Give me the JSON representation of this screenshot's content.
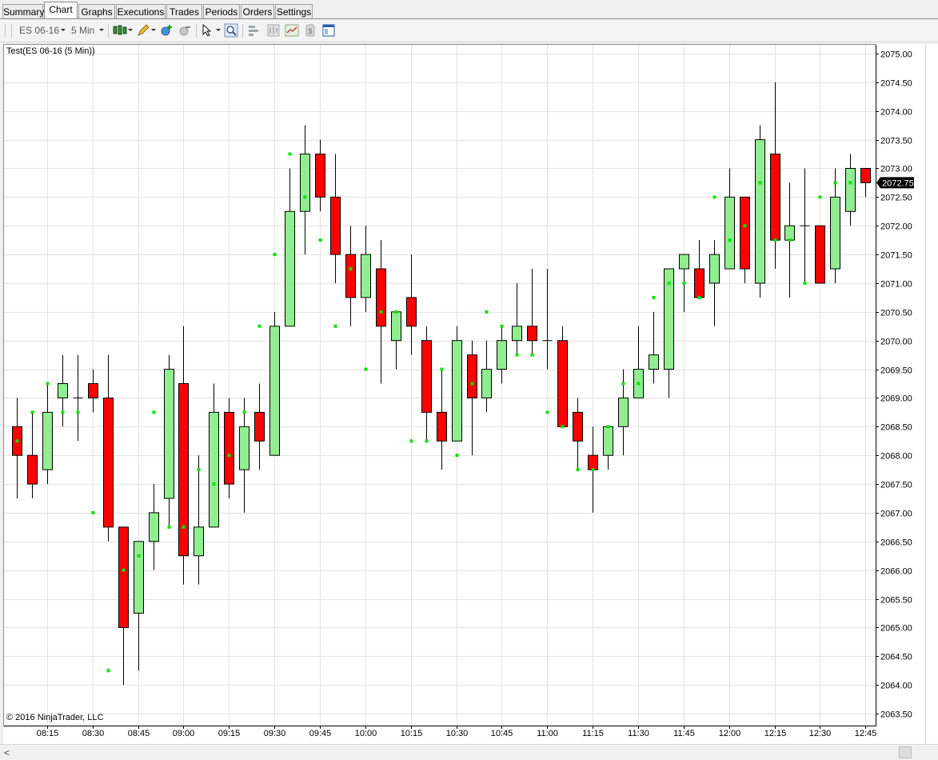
{
  "tabs": [
    {
      "label": "Summary",
      "active": false
    },
    {
      "label": "Chart",
      "active": true
    },
    {
      "label": "Graphs",
      "active": false
    },
    {
      "label": "Executions",
      "active": false
    },
    {
      "label": "Trades",
      "active": false
    },
    {
      "label": "Periods",
      "active": false
    },
    {
      "label": "Orders",
      "active": false
    },
    {
      "label": "Settings",
      "active": false
    }
  ],
  "toolbar": {
    "instrument": "ES 06-16",
    "interval": "5 Min"
  },
  "chart": {
    "title": "Test(ES 06-16 (5 Min))",
    "copyright": "© 2016 NinjaTrader, LLC",
    "last_price_label": "2072.75",
    "colors": {
      "up": "#90ee90",
      "down": "#ff0000",
      "marker": "#00e600",
      "grid": "#e3e3e3"
    }
  },
  "chart_data": {
    "type": "candlestick",
    "interval_minutes": 5,
    "ylim": [
      2063.25,
      2075.25
    ],
    "y_ticks": [
      2063.5,
      2064.0,
      2064.5,
      2065.0,
      2065.5,
      2066.0,
      2066.5,
      2067.0,
      2067.5,
      2068.0,
      2068.5,
      2069.0,
      2069.5,
      2070.0,
      2070.5,
      2071.0,
      2071.5,
      2072.0,
      2072.5,
      2073.0,
      2073.5,
      2074.0,
      2074.5,
      2075.0
    ],
    "x_ticks": [
      "08:15",
      "08:30",
      "08:45",
      "09:00",
      "09:15",
      "09:30",
      "09:45",
      "10:00",
      "10:15",
      "10:30",
      "10:45",
      "11:00",
      "11:15",
      "11:30",
      "11:45",
      "12:00",
      "12:15",
      "12:30",
      "12:45"
    ],
    "bars": [
      {
        "o": 2068.5,
        "h": 2069.0,
        "l": 2067.25,
        "c": 2068.0,
        "m": 2068.25
      },
      {
        "o": 2068.0,
        "h": 2068.75,
        "l": 2067.25,
        "c": 2067.5,
        "m": 2068.75
      },
      {
        "o": 2067.75,
        "h": 2069.25,
        "l": 2067.5,
        "c": 2068.75,
        "m": 2069.25
      },
      {
        "o": 2069.0,
        "h": 2069.75,
        "l": 2068.5,
        "c": 2069.25,
        "m": 2068.75
      },
      {
        "o": 2069.0,
        "h": 2069.75,
        "l": 2068.25,
        "c": 2069.0,
        "m": 2068.75
      },
      {
        "o": 2069.25,
        "h": 2069.5,
        "l": 2068.75,
        "c": 2069.0,
        "m": 2067.0
      },
      {
        "o": 2069.0,
        "h": 2069.75,
        "l": 2066.5,
        "c": 2066.75,
        "m": 2064.25
      },
      {
        "o": 2066.75,
        "h": 2066.75,
        "l": 2064.0,
        "c": 2065.0,
        "m": 2066.0
      },
      {
        "o": 2065.25,
        "h": 2066.5,
        "l": 2064.25,
        "c": 2066.5,
        "m": 2066.25
      },
      {
        "o": 2066.5,
        "h": 2067.5,
        "l": 2066.0,
        "c": 2067.0,
        "m": 2068.75
      },
      {
        "o": 2067.25,
        "h": 2069.75,
        "l": 2066.75,
        "c": 2069.5,
        "m": 2066.75
      },
      {
        "o": 2069.25,
        "h": 2070.25,
        "l": 2065.75,
        "c": 2066.25,
        "m": 2066.75
      },
      {
        "o": 2066.25,
        "h": 2068.0,
        "l": 2065.75,
        "c": 2066.75,
        "m": 2067.75
      },
      {
        "o": 2066.75,
        "h": 2069.25,
        "l": 2066.75,
        "c": 2068.75,
        "m": 2067.5
      },
      {
        "o": 2068.75,
        "h": 2069.0,
        "l": 2067.25,
        "c": 2067.5,
        "m": 2068.0
      },
      {
        "o": 2067.75,
        "h": 2069.0,
        "l": 2067.0,
        "c": 2068.5,
        "m": 2068.75
      },
      {
        "o": 2068.75,
        "h": 2069.25,
        "l": 2067.75,
        "c": 2068.25,
        "m": 2070.25
      },
      {
        "o": 2068.0,
        "h": 2070.5,
        "l": 2068.0,
        "c": 2070.25,
        "m": 2071.5
      },
      {
        "o": 2070.25,
        "h": 2073.0,
        "l": 2070.25,
        "c": 2072.25,
        "m": 2073.25
      },
      {
        "o": 2072.25,
        "h": 2073.75,
        "l": 2071.5,
        "c": 2073.25,
        "m": 2072.5
      },
      {
        "o": 2073.25,
        "h": 2073.5,
        "l": 2072.25,
        "c": 2072.5,
        "m": 2071.75
      },
      {
        "o": 2072.5,
        "h": 2073.25,
        "l": 2071.0,
        "c": 2071.5,
        "m": 2070.25
      },
      {
        "o": 2071.5,
        "h": 2072.0,
        "l": 2070.25,
        "c": 2070.75,
        "m": 2071.25
      },
      {
        "o": 2070.75,
        "h": 2072.0,
        "l": 2070.5,
        "c": 2071.5,
        "m": 2069.5
      },
      {
        "o": 2071.25,
        "h": 2071.75,
        "l": 2069.25,
        "c": 2070.25,
        "m": 2070.5
      },
      {
        "o": 2070.0,
        "h": 2070.5,
        "l": 2069.5,
        "c": 2070.5,
        "m": 2070.5
      },
      {
        "o": 2070.75,
        "h": 2071.5,
        "l": 2069.75,
        "c": 2070.25,
        "m": 2068.25
      },
      {
        "o": 2070.0,
        "h": 2070.25,
        "l": 2068.25,
        "c": 2068.75,
        "m": 2068.25
      },
      {
        "o": 2068.75,
        "h": 2069.5,
        "l": 2067.75,
        "c": 2068.25,
        "m": 2069.5
      },
      {
        "o": 2068.25,
        "h": 2070.25,
        "l": 2068.25,
        "c": 2070.0,
        "m": 2068.0
      },
      {
        "o": 2069.75,
        "h": 2070.0,
        "l": 2068.0,
        "c": 2069.0,
        "m": 2069.25
      },
      {
        "o": 2069.0,
        "h": 2070.0,
        "l": 2068.75,
        "c": 2069.5,
        "m": 2070.5
      },
      {
        "o": 2069.5,
        "h": 2070.25,
        "l": 2069.25,
        "c": 2070.0,
        "m": 2070.25
      },
      {
        "o": 2070.0,
        "h": 2071.0,
        "l": 2069.75,
        "c": 2070.25,
        "m": 2069.75
      },
      {
        "o": 2070.25,
        "h": 2071.25,
        "l": 2069.75,
        "c": 2070.0,
        "m": 2069.75
      },
      {
        "o": 2070.0,
        "h": 2071.25,
        "l": 2069.5,
        "c": 2070.0,
        "m": 2068.75
      },
      {
        "o": 2070.0,
        "h": 2070.25,
        "l": 2068.5,
        "c": 2068.5,
        "m": 2068.5
      },
      {
        "o": 2068.75,
        "h": 2069.0,
        "l": 2067.75,
        "c": 2068.25,
        "m": 2067.75
      },
      {
        "o": 2068.0,
        "h": 2068.5,
        "l": 2067.0,
        "c": 2067.75,
        "m": 2067.75
      },
      {
        "o": 2068.0,
        "h": 2068.5,
        "l": 2067.75,
        "c": 2068.5,
        "m": 2068.5
      },
      {
        "o": 2068.5,
        "h": 2069.5,
        "l": 2068.0,
        "c": 2069.0,
        "m": 2069.25
      },
      {
        "o": 2069.0,
        "h": 2070.25,
        "l": 2069.0,
        "c": 2069.5,
        "m": 2069.25
      },
      {
        "o": 2069.5,
        "h": 2070.5,
        "l": 2069.25,
        "c": 2069.75,
        "m": 2070.75
      },
      {
        "o": 2069.5,
        "h": 2071.25,
        "l": 2069.0,
        "c": 2071.25,
        "m": 2071.0
      },
      {
        "o": 2071.25,
        "h": 2071.5,
        "l": 2070.5,
        "c": 2071.5,
        "m": 2071.0
      },
      {
        "o": 2071.25,
        "h": 2071.75,
        "l": 2070.75,
        "c": 2070.75,
        "m": 2070.75
      },
      {
        "o": 2071.0,
        "h": 2071.75,
        "l": 2070.25,
        "c": 2071.5,
        "m": 2072.5
      },
      {
        "o": 2071.25,
        "h": 2073.0,
        "l": 2071.25,
        "c": 2072.5,
        "m": 2071.75
      },
      {
        "o": 2072.5,
        "h": 2072.5,
        "l": 2071.0,
        "c": 2071.25,
        "m": 2072.0
      },
      {
        "o": 2071.0,
        "h": 2073.75,
        "l": 2070.75,
        "c": 2073.5,
        "m": 2072.75
      },
      {
        "o": 2073.25,
        "h": 2074.5,
        "l": 2071.25,
        "c": 2071.75,
        "m": 2071.75
      },
      {
        "o": 2071.75,
        "h": 2072.75,
        "l": 2070.75,
        "c": 2072.0,
        "m": 2071.75
      },
      {
        "o": 2072.0,
        "h": 2073.0,
        "l": 2071.0,
        "c": 2072.0,
        "m": 2071.0
      },
      {
        "o": 2072.0,
        "h": 2072.0,
        "l": 2071.0,
        "c": 2071.0,
        "m": 2072.5
      },
      {
        "o": 2071.25,
        "h": 2073.0,
        "l": 2071.0,
        "c": 2072.5,
        "m": 2072.75
      },
      {
        "o": 2072.25,
        "h": 2073.25,
        "l": 2072.0,
        "c": 2073.0,
        "m": 2072.75
      },
      {
        "o": 2073.0,
        "h": 2073.0,
        "l": 2072.5,
        "c": 2072.75,
        "m": null
      }
    ]
  }
}
